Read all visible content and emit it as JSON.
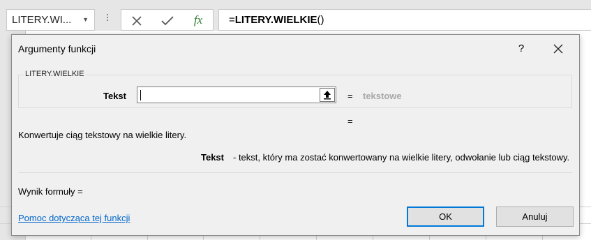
{
  "name_box": {
    "value": "LITERY.WI..."
  },
  "formula_bar": {
    "prefix": "=",
    "function_name": "LITERY.WIELKIE",
    "suffix": "()",
    "fx_label": "fx"
  },
  "dialog": {
    "title": "Argumenty funkcji",
    "help_label": "?",
    "group_label": "LITERY.WIELKIE",
    "argument": {
      "name": "Tekst",
      "value": "",
      "equals": "=",
      "type_hint": "tekstowe"
    },
    "result_equals": "=",
    "function_description": "Konwertuje ciąg tekstowy na wielkie litery.",
    "argument_description": {
      "name": "Tekst",
      "text": "- tekst, który ma zostać konwertowany na wielkie litery, odwołanie lub ciąg tekstowy."
    },
    "formula_result": "Wynik formuły =",
    "help_link": "Pomoc dotycząca tej funkcji",
    "ok_label": "OK",
    "cancel_label": "Anuluj"
  },
  "colors": {
    "link": "#0066cc",
    "ok_border": "#0078d7",
    "type_hint": "#a8a8a8"
  }
}
